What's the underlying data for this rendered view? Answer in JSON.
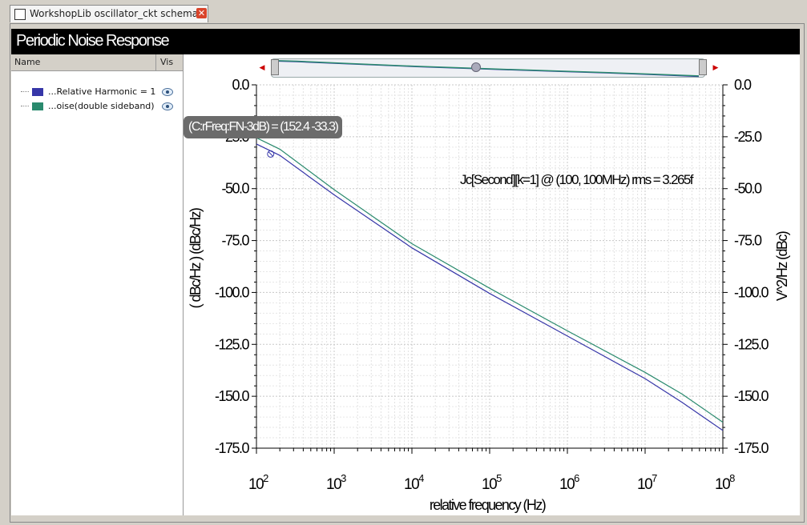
{
  "tab": {
    "title": "WorkshopLib oscillator_ckt schema...",
    "close_symbol": "✕"
  },
  "window": {
    "title": "Periodic Noise Response"
  },
  "legend": {
    "column_name": "Name",
    "column_vis": "Vis",
    "items": [
      {
        "label": "...Relative Harmonic = 1",
        "color": "#3636a8",
        "visible": true
      },
      {
        "label": "...oise(double sideband)",
        "color": "#2a8a6e",
        "visible": true
      }
    ]
  },
  "marker": {
    "label": "(C:rFreq:FN-3dB) = (152.4 -33.3)"
  },
  "annotation": {
    "text": "Jc[Second][k=1] @ (100, 100MHz) rms = 3.265f"
  },
  "icons": {
    "tab": "schematic-icon",
    "eye": "eye-icon",
    "scroll_left": "left-arrow-icon",
    "scroll_right": "right-arrow-icon"
  },
  "chart_data": {
    "type": "line",
    "xlabel": "relative frequency (Hz)",
    "ylabel_left": "( dBc/Hz ) (dBc/Hz)",
    "ylabel_right": "V^2/Hz (dBc)",
    "xscale": "log",
    "xlim": [
      100,
      100000000
    ],
    "ylim": [
      -175,
      0
    ],
    "x_ticks": [
      "10^2",
      "10^3",
      "10^4",
      "10^5",
      "10^6",
      "10^7",
      "10^8"
    ],
    "y_ticks": [
      "0.0",
      "-25.0",
      "-50.0",
      "-75.0",
      "-100.0",
      "-125.0",
      "-150.0",
      "-175.0"
    ],
    "grid": true,
    "series": [
      {
        "name": "...Relative Harmonic = 1",
        "color": "#3636a8",
        "x": [
          100,
          200,
          1000,
          10000,
          100000,
          1000000,
          10000000,
          30000000,
          100000000
        ],
        "y": [
          -28.5,
          -34,
          -53,
          -78.5,
          -100.5,
          -121,
          -141.5,
          -153,
          -166.5
        ]
      },
      {
        "name": "...oise(double sideband)",
        "color": "#2a8a6e",
        "x": [
          100,
          200,
          1000,
          10000,
          100000,
          1000000,
          10000000,
          30000000,
          100000000
        ],
        "y": [
          -25.5,
          -31,
          -50.5,
          -76.5,
          -98,
          -118.5,
          -138.5,
          -149,
          -162.5
        ]
      }
    ],
    "marker_point": {
      "x": 152.4,
      "y": -33.3
    }
  }
}
